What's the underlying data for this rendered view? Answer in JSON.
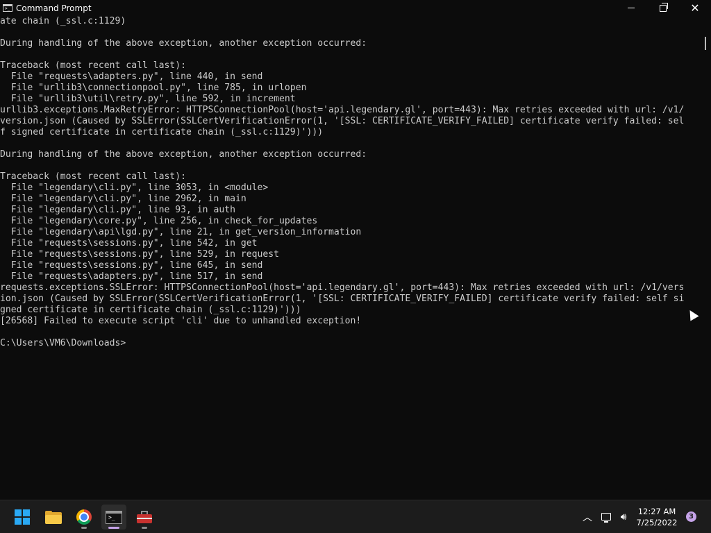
{
  "window": {
    "title": "Command Prompt",
    "icon": "cmd-icon"
  },
  "controls": {
    "minimize": "minimize-icon",
    "maximize": "restore-icon",
    "close": "close-icon"
  },
  "console": {
    "lines": [
      "ate chain (_ssl.c:1129)",
      "",
      "During handling of the above exception, another exception occurred:",
      "",
      "Traceback (most recent call last):",
      "  File \"requests\\adapters.py\", line 440, in send",
      "  File \"urllib3\\connectionpool.py\", line 785, in urlopen",
      "  File \"urllib3\\util\\retry.py\", line 592, in increment",
      "urllib3.exceptions.MaxRetryError: HTTPSConnectionPool(host='api.legendary.gl', port=443): Max retries exceeded with url: /v1/",
      "version.json (Caused by SSLError(SSLCertVerificationError(1, '[SSL: CERTIFICATE_VERIFY_FAILED] certificate verify failed: sel",
      "f signed certificate in certificate chain (_ssl.c:1129)')))",
      "",
      "During handling of the above exception, another exception occurred:",
      "",
      "Traceback (most recent call last):",
      "  File \"legendary\\cli.py\", line 3053, in <module>",
      "  File \"legendary\\cli.py\", line 2962, in main",
      "  File \"legendary\\cli.py\", line 93, in auth",
      "  File \"legendary\\core.py\", line 256, in check_for_updates",
      "  File \"legendary\\api\\lgd.py\", line 21, in get_version_information",
      "  File \"requests\\sessions.py\", line 542, in get",
      "  File \"requests\\sessions.py\", line 529, in request",
      "  File \"requests\\sessions.py\", line 645, in send",
      "  File \"requests\\adapters.py\", line 517, in send",
      "requests.exceptions.SSLError: HTTPSConnectionPool(host='api.legendary.gl', port=443): Max retries exceeded with url: /v1/vers",
      "ion.json (Caused by SSLError(SSLCertVerificationError(1, '[SSL: CERTIFICATE_VERIFY_FAILED] certificate verify failed: self si",
      "gned certificate in certificate chain (_ssl.c:1129)')))",
      "[26568] Failed to execute script 'cli' due to unhandled exception!",
      "",
      "C:\\Users\\VM6\\Downloads>"
    ]
  },
  "taskbar": {
    "apps": [
      {
        "name": "start",
        "icon": "windows-start-icon",
        "active": false
      },
      {
        "name": "file-explorer",
        "icon": "folder-icon",
        "active": false
      },
      {
        "name": "chrome",
        "icon": "chrome-icon",
        "active": false
      },
      {
        "name": "command-prompt",
        "icon": "terminal-icon",
        "active": true
      },
      {
        "name": "toolbox",
        "icon": "toolbox-icon",
        "active": false
      }
    ],
    "tray": {
      "time": "12:27 AM",
      "date": "7/25/2022",
      "notifications": "3"
    }
  },
  "colors": {
    "console_bg": "#0c0c0c",
    "console_text": "#cccccc",
    "taskbar_bg": "#1c1c1c",
    "accent": "#c5a3e8"
  }
}
